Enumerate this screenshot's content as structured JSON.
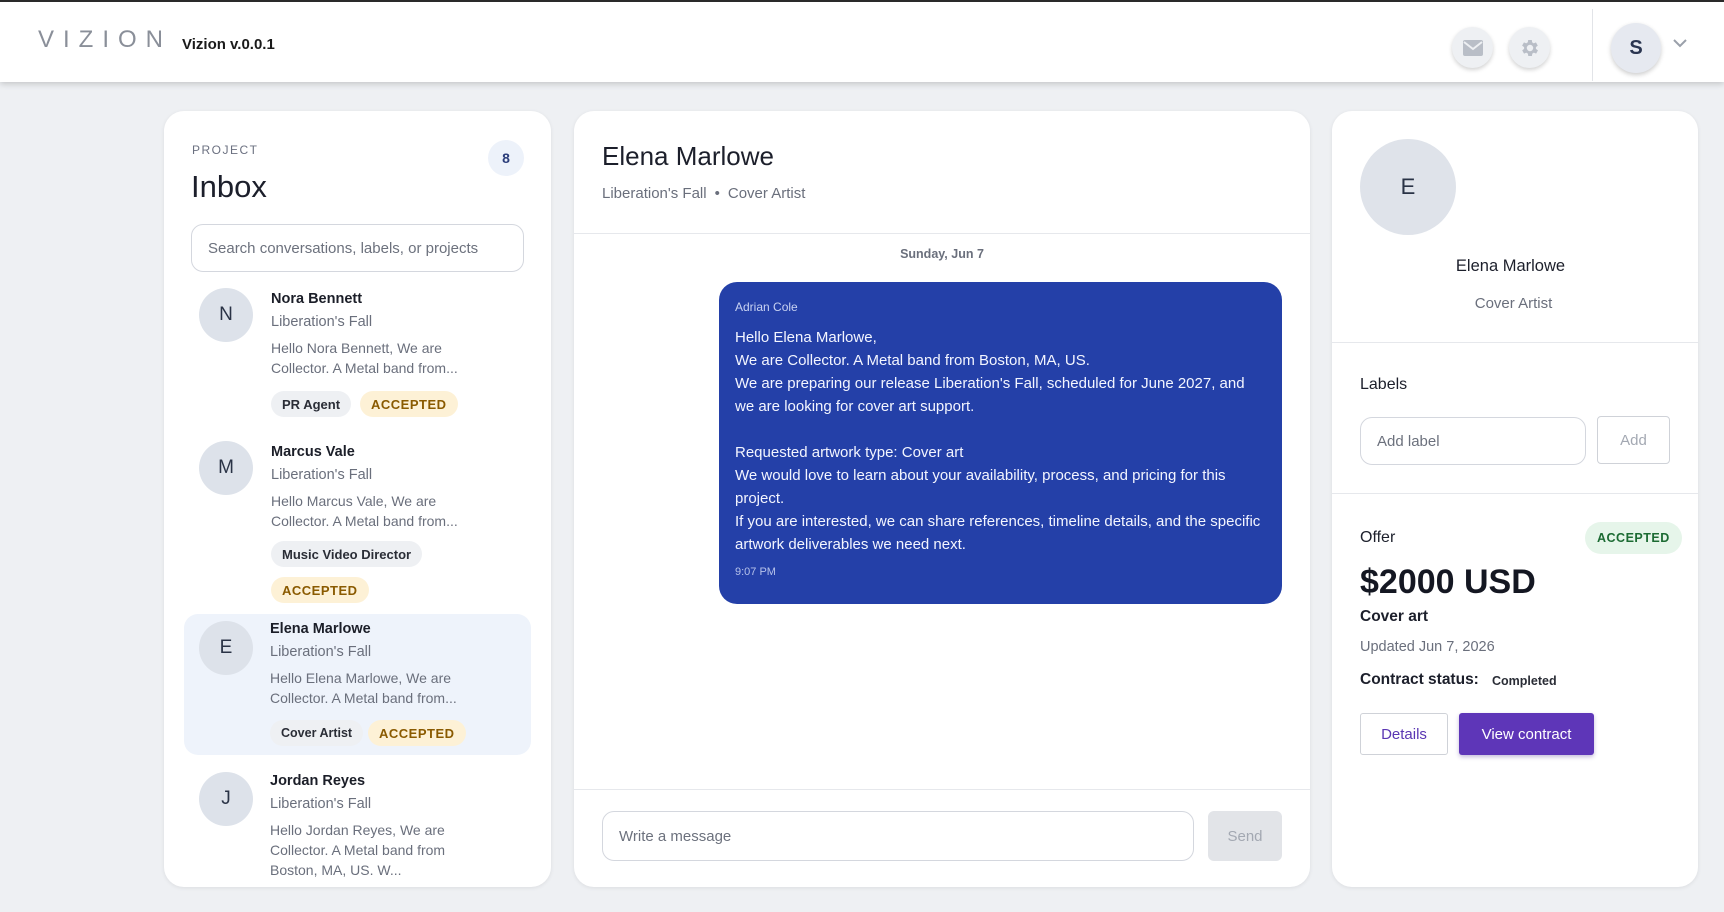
{
  "header": {
    "logo": "VIZION",
    "version": "Vizion v.0.0.1",
    "mail_icon": "mail-icon",
    "settings_icon": "gear-icon",
    "user_initial": "S"
  },
  "inbox": {
    "project_label": "PROJECT",
    "title": "Inbox",
    "count": "8",
    "search_placeholder": "Search conversations, labels, or projects",
    "conversations": [
      {
        "initial": "N",
        "name": "Nora Bennett",
        "project": "Liberation's Fall",
        "snippet": "Hello Nora Bennett, We are Collector. A Metal band from...",
        "role": "PR Agent",
        "status": "ACCEPTED"
      },
      {
        "initial": "M",
        "name": "Marcus Vale",
        "project": "Liberation's Fall",
        "snippet": "Hello Marcus Vale, We are Collector. A Metal band from...",
        "role": "Music Video Director",
        "status": "ACCEPTED"
      },
      {
        "initial": "E",
        "name": "Elena Marlowe",
        "project": "Liberation's Fall",
        "snippet": "Hello Elena Marlowe, We are Collector. A Metal band from...",
        "role": "Cover Artist",
        "status": "ACCEPTED"
      },
      {
        "initial": "J",
        "name": "Jordan Reyes",
        "project": "Liberation's Fall",
        "snippet": "Hello Jordan Reyes, We are Collector. A Metal band from Boston, MA, US. W..."
      }
    ]
  },
  "chat": {
    "name": "Elena Marlowe",
    "project": "Liberation's Fall",
    "separator": "•",
    "role": "Cover Artist",
    "date": "Sunday, Jun 7",
    "message": {
      "sender": "Adrian Cole",
      "body": "Hello Elena Marlowe,\nWe are Collector. A Metal band from Boston, MA, US.\nWe are preparing our release Liberation's Fall, scheduled for June 2027, and we are looking for cover art support.\n\nRequested artwork type: Cover art\nWe would love to learn about your availability, process, and pricing for this project.\nIf you are interested, we can share references, timeline details, and the specific artwork deliverables we need next.",
      "time": "9:07 PM"
    },
    "input_placeholder": "Write a message",
    "send_label": "Send"
  },
  "side": {
    "initial": "E",
    "name": "Elena Marlowe",
    "role": "Cover Artist",
    "labels_title": "Labels",
    "label_placeholder": "Add label",
    "add_label": "Add",
    "offer_title": "Offer",
    "offer_status": "ACCEPTED",
    "price": "$2000 USD",
    "offer_type": "Cover art",
    "updated": "Updated Jun 7, 2026",
    "contract_label": "Contract status:",
    "contract_value": "Completed",
    "details_label": "Details",
    "view_contract_label": "View contract"
  }
}
